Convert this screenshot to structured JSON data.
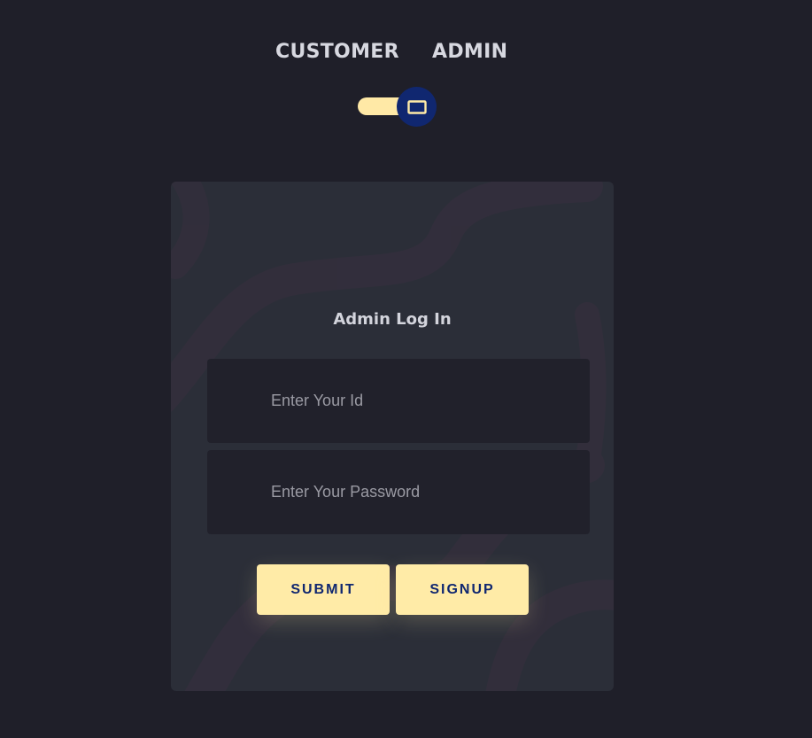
{
  "mode_tabs": {
    "customer_label": "CUSTOMER",
    "admin_label": "ADMIN"
  },
  "mode_toggle": {
    "state": "admin",
    "icon": "monitor-icon"
  },
  "login_card": {
    "title": "Admin Log In",
    "id_field": {
      "value": "",
      "placeholder": "Enter Your Id"
    },
    "password_field": {
      "value": "",
      "placeholder": "Enter Your Password"
    },
    "submit_label": "SUBMIT",
    "signup_label": "SIGNUP"
  },
  "colors": {
    "page_background": "#1f1f29",
    "card_background": "#2b2e38",
    "accent_yellow": "#ffeba7",
    "accent_navy": "#102770",
    "text_light": "#d7d8e0"
  }
}
